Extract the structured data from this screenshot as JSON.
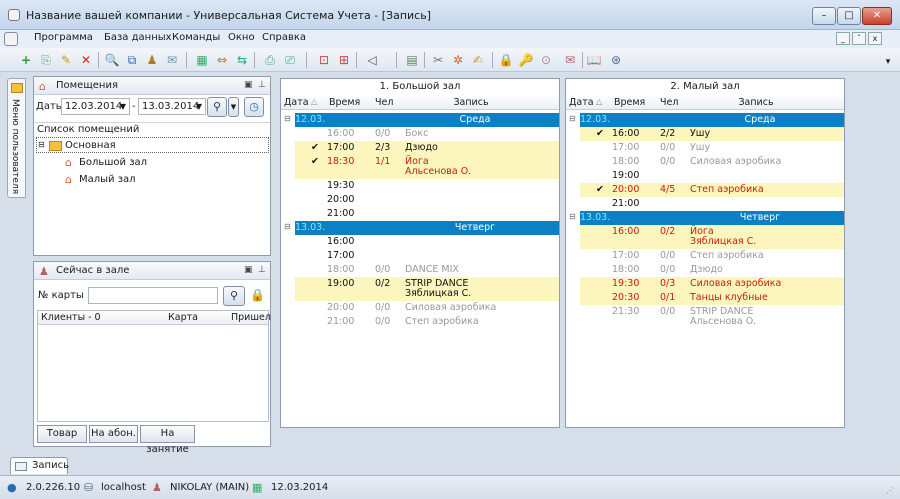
{
  "window": {
    "title": "Название вашей компании - Универсальная Система Учета - [Запись]",
    "minimize": "–",
    "maximize": "□",
    "close": "✕"
  },
  "menu": {
    "items": [
      "Программа",
      "База данных",
      "Команды",
      "Окно",
      "Справка"
    ],
    "mdi": [
      "_",
      "ˆ",
      "x"
    ],
    "overflow": "▾"
  },
  "toolbar": {
    "icons": [
      "+",
      "⎘",
      "✎",
      "✕",
      "🔍",
      "⧉",
      "♟",
      "✉",
      "▦",
      "⇔",
      "⇆",
      "⎙",
      "⎚",
      "⊡",
      "⊞",
      "◁",
      "▤",
      "✂",
      "✲",
      "✍",
      "🔒",
      "🔑",
      "⊙",
      "✉",
      "📖",
      "⊛"
    ]
  },
  "side_tab": {
    "label": "Меню пользователя"
  },
  "rooms_panel": {
    "title": "Помещения",
    "dates_label": "Даты",
    "date_from": "12.03.2014",
    "dash": "-",
    "date_to": "13.03.2014",
    "list_header": "Список помещений",
    "tree": {
      "root": "Основная",
      "children": [
        "Большой зал",
        "Малый зал"
      ]
    }
  },
  "now_panel": {
    "title": "Сейчас в зале",
    "card_label": "№ карты",
    "card_value": "",
    "columns": [
      "Клиенты - 0",
      "Карта",
      "Пришел"
    ],
    "buttons": [
      "Товар",
      "На абон.",
      "На занятие"
    ]
  },
  "schedules": [
    {
      "title": "1. Большой зал",
      "columns": [
        "Дата",
        "Время",
        "Чел",
        "Запись"
      ],
      "days": [
        {
          "date": "12.03.",
          "day": "Среда",
          "rows": [
            {
              "time": "16:00",
              "count": "0/0",
              "name": "Бокс",
              "name2": "",
              "style": "gray",
              "hl": false,
              "check": false
            },
            {
              "time": "17:00",
              "count": "2/3",
              "name": "Дзюдо",
              "name2": "",
              "style": "blk",
              "hl": true,
              "check": true
            },
            {
              "time": "18:30",
              "count": "1/1",
              "name": "Йога",
              "name2": "Альсенова О.",
              "style": "red",
              "hl": true,
              "check": true
            },
            {
              "time": "19:30",
              "count": "",
              "name": "",
              "name2": "",
              "style": "blk",
              "hl": false,
              "check": false
            },
            {
              "time": "20:00",
              "count": "",
              "name": "",
              "name2": "",
              "style": "blk",
              "hl": false,
              "check": false
            },
            {
              "time": "21:00",
              "count": "",
              "name": "",
              "name2": "",
              "style": "blk",
              "hl": false,
              "check": false
            }
          ]
        },
        {
          "date": "13.03.",
          "day": "Четверг",
          "rows": [
            {
              "time": "16:00",
              "count": "",
              "name": "",
              "name2": "",
              "style": "blk",
              "hl": false,
              "check": false
            },
            {
              "time": "17:00",
              "count": "",
              "name": "",
              "name2": "",
              "style": "blk",
              "hl": false,
              "check": false
            },
            {
              "time": "18:00",
              "count": "0/0",
              "name": "DANCE MIX",
              "name2": "",
              "style": "gray",
              "hl": false,
              "check": false
            },
            {
              "time": "19:00",
              "count": "0/2",
              "name": "STRIP DANCE",
              "name2": "Зяблицкая С.",
              "style": "blk",
              "hl": true,
              "check": false
            },
            {
              "time": "20:00",
              "count": "0/0",
              "name": "Силовая аэробика",
              "name2": "",
              "style": "gray",
              "hl": false,
              "check": false
            },
            {
              "time": "21:00",
              "count": "0/0",
              "name": "Степ аэробика",
              "name2": "",
              "style": "gray",
              "hl": false,
              "check": false
            }
          ]
        }
      ]
    },
    {
      "title": "2. Малый зал",
      "columns": [
        "Дата",
        "Время",
        "Чел",
        "Запись"
      ],
      "days": [
        {
          "date": "12.03.",
          "day": "Среда",
          "rows": [
            {
              "time": "16:00",
              "count": "2/2",
              "name": "Ушу",
              "name2": "",
              "style": "blk",
              "hl": true,
              "check": true
            },
            {
              "time": "17:00",
              "count": "0/0",
              "name": "Ушу",
              "name2": "",
              "style": "gray",
              "hl": false,
              "check": false
            },
            {
              "time": "18:00",
              "count": "0/0",
              "name": "Силовая аэробика",
              "name2": "",
              "style": "gray",
              "hl": false,
              "check": false
            },
            {
              "time": "19:00",
              "count": "",
              "name": "",
              "name2": "",
              "style": "blk",
              "hl": false,
              "check": false
            },
            {
              "time": "20:00",
              "count": "4/5",
              "name": "Степ аэробика",
              "name2": "",
              "style": "red",
              "hl": true,
              "check": true
            },
            {
              "time": "21:00",
              "count": "",
              "name": "",
              "name2": "",
              "style": "blk",
              "hl": false,
              "check": false
            }
          ]
        },
        {
          "date": "13.03.",
          "day": "Четверг",
          "rows": [
            {
              "time": "16:00",
              "count": "0/2",
              "name": "Йога",
              "name2": "Зяблицкая С.",
              "style": "red",
              "hl": true,
              "check": false
            },
            {
              "time": "17:00",
              "count": "0/0",
              "name": "Степ аэробика",
              "name2": "",
              "style": "gray",
              "hl": false,
              "check": false
            },
            {
              "time": "18:00",
              "count": "0/0",
              "name": "Дзюдо",
              "name2": "",
              "style": "gray",
              "hl": false,
              "check": false
            },
            {
              "time": "19:30",
              "count": "0/3",
              "name": "Силовая аэробика",
              "name2": "",
              "style": "red",
              "hl": true,
              "check": false
            },
            {
              "time": "20:30",
              "count": "0/1",
              "name": "Танцы клубные",
              "name2": "",
              "style": "red",
              "hl": true,
              "check": false
            },
            {
              "time": "21:30",
              "count": "0/0",
              "name": "STRIP DANCE",
              "name2": "Альсенова О.",
              "style": "gray",
              "hl": false,
              "check": false
            }
          ]
        }
      ]
    }
  ],
  "bottom_tab": {
    "label": "Запись"
  },
  "status": {
    "version": "2.0.226.10",
    "host": "localhost",
    "user": "NIKOLAY (MAIN)",
    "date": "12.03.2014"
  }
}
